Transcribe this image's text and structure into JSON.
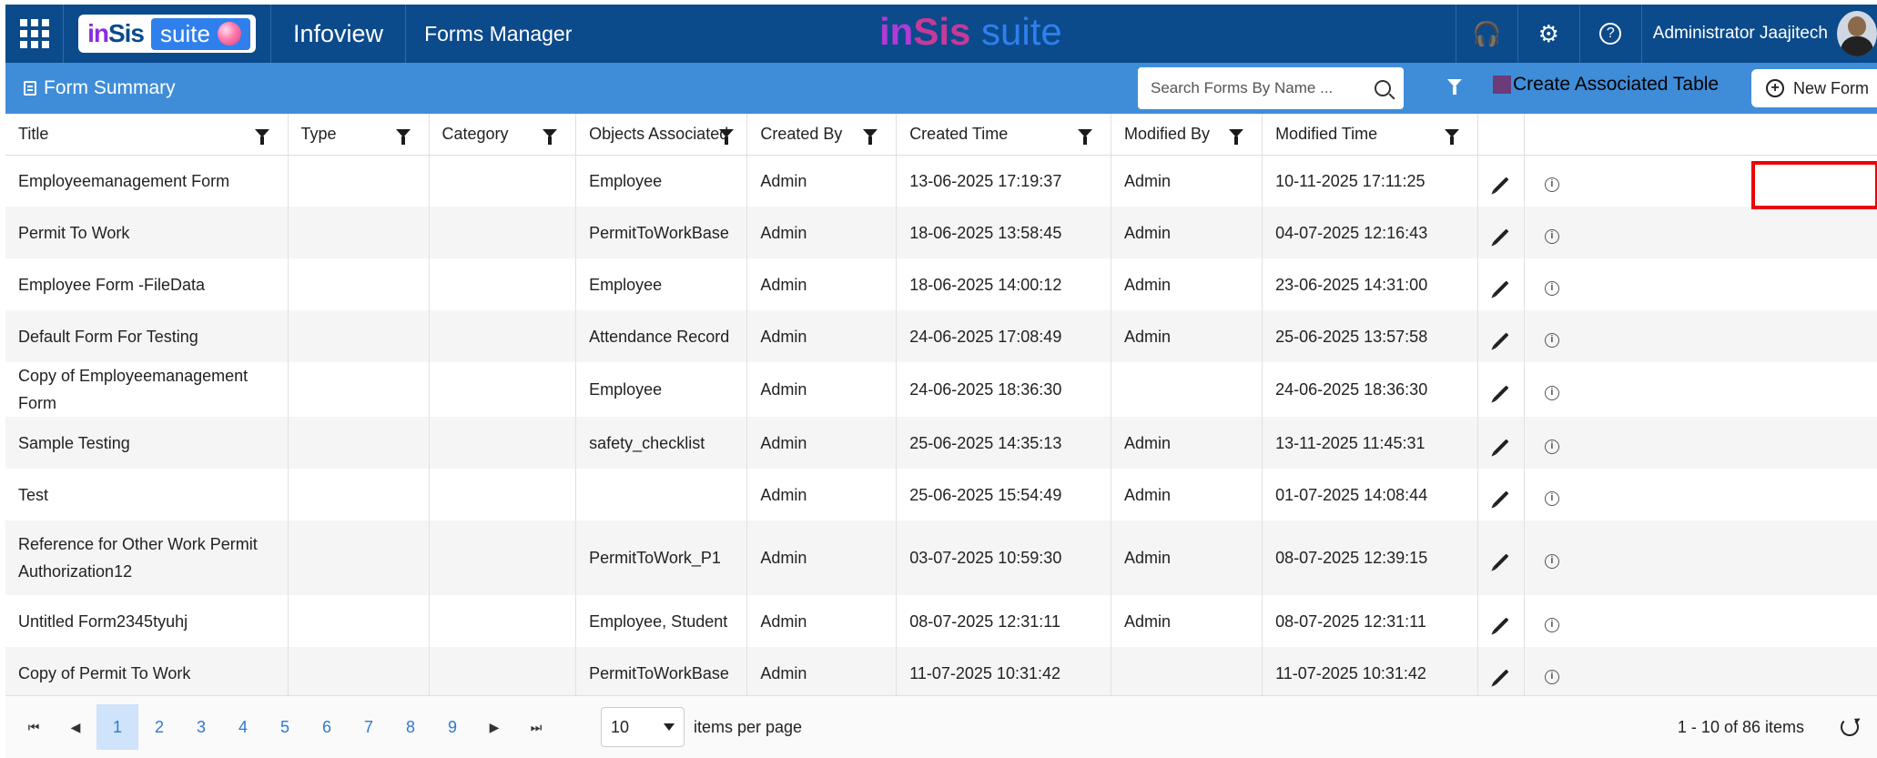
{
  "header": {
    "brand_in": "in",
    "brand_sis": "Sis",
    "brand_suite": "suite",
    "app_title": "Infoview",
    "module": "Forms Manager",
    "center_logo_i": "in",
    "center_logo_s": "Sis",
    "center_logo_suite": "suite",
    "user": "Administrator Jaajitech",
    "icons": [
      "apps-grid-icon",
      "headset-icon",
      "gear-icon",
      "help-icon"
    ]
  },
  "toolbar": {
    "title": "Form Summary",
    "search_placeholder": "Search Forms By Name ...",
    "associated_table": "Create Associated Table",
    "new_form": "New Form"
  },
  "columns": [
    "Title",
    "Type",
    "Category",
    "Objects Associated",
    "Created By",
    "Created Time",
    "Modified By",
    "Modified Time"
  ],
  "rows": [
    [
      "Employeemanagement Form",
      "",
      "",
      "Employee",
      "Admin",
      "13-06-2025 17:19:37",
      "Admin",
      "10-11-2025 17:11:25"
    ],
    [
      "Permit To Work",
      "",
      "",
      "PermitToWorkBase",
      "Admin",
      "18-06-2025 13:58:45",
      "Admin",
      "04-07-2025 12:16:43"
    ],
    [
      "Employee Form -FileData",
      "",
      "",
      "Employee",
      "Admin",
      "18-06-2025 14:00:12",
      "Admin",
      "23-06-2025 14:31:00"
    ],
    [
      "Default Form For Testing",
      "",
      "",
      "Attendance Record",
      "Admin",
      "24-06-2025 17:08:49",
      "Admin",
      "25-06-2025 13:57:58"
    ],
    [
      "Copy of Employeemanagement Form",
      "",
      "",
      "Employee",
      "Admin",
      "24-06-2025 18:36:30",
      "",
      "24-06-2025 18:36:30"
    ],
    [
      "Sample Testing",
      "",
      "",
      "safety_checklist",
      "Admin",
      "25-06-2025 14:35:13",
      "Admin",
      "13-11-2025 11:45:31"
    ],
    [
      "Test",
      "",
      "",
      "",
      "Admin",
      "25-06-2025 15:54:49",
      "Admin",
      "01-07-2025 14:08:44"
    ],
    [
      "Reference for Other Work Permit Authorization12",
      "",
      "",
      "PermitToWork_P1",
      "Admin",
      "03-07-2025 10:59:30",
      "Admin",
      "08-07-2025 12:39:15"
    ],
    [
      "Untitled Form2345tyuhj",
      "",
      "",
      "Employee, Student",
      "Admin",
      "08-07-2025 12:31:11",
      "Admin",
      "08-07-2025 12:31:11"
    ],
    [
      "Copy of Permit To Work",
      "",
      "",
      "PermitToWorkBase",
      "Admin",
      "11-07-2025 10:31:42",
      "",
      "11-07-2025 10:31:42"
    ]
  ],
  "pager": {
    "pages": [
      "1",
      "2",
      "3",
      "4",
      "5",
      "6",
      "7",
      "8",
      "9"
    ],
    "current": "1",
    "page_size": "10",
    "per_page_label": "items per page",
    "count_label": "1 - 10 of 86 items"
  },
  "colors": {
    "topbar": "#0b4a8b",
    "summary_bar": "#3f8dd8",
    "highlight": "#e00000"
  }
}
